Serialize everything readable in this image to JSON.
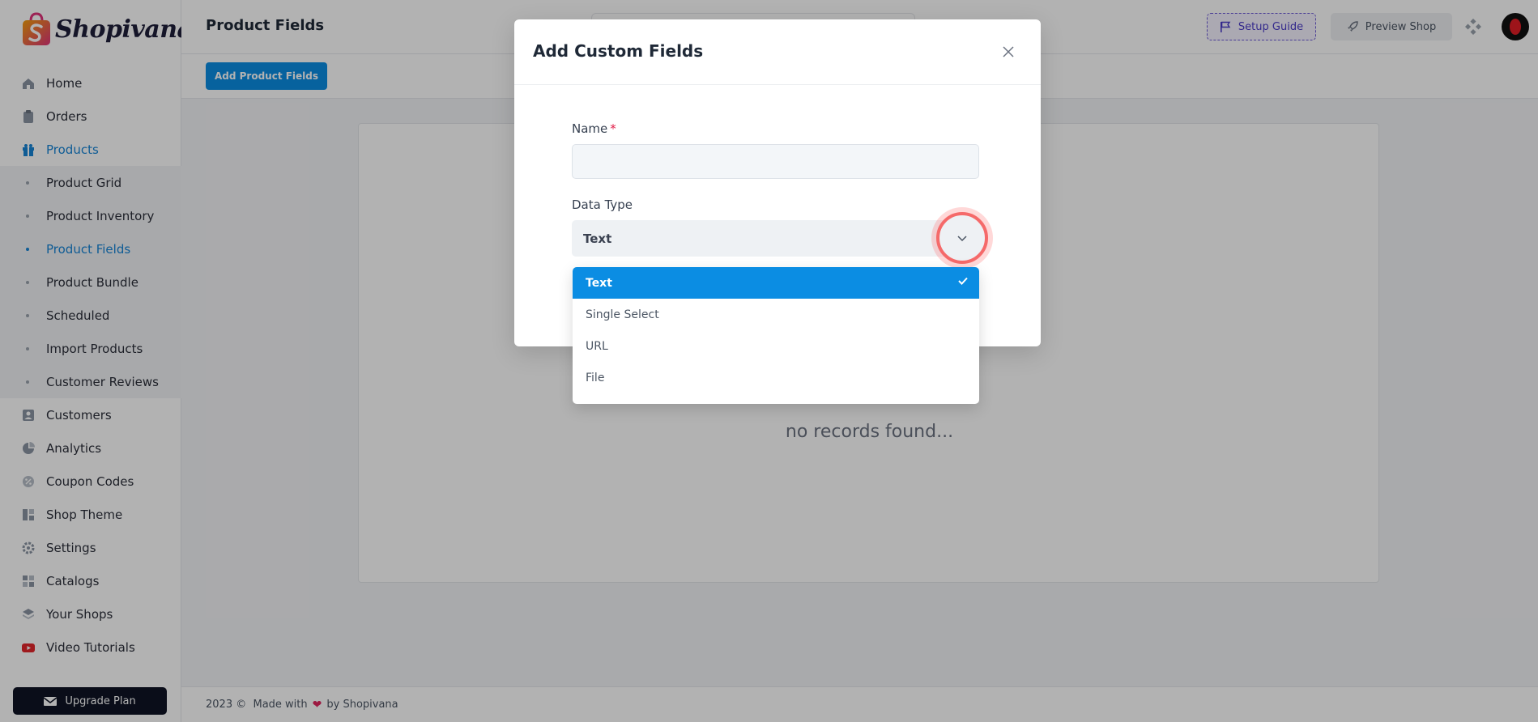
{
  "brand": {
    "name": "Shopivana",
    "colors": {
      "accent": "#0b8de3",
      "active_nav": "#1684d6",
      "logo_pink": "#e0337a",
      "logo_orange": "#f59e0b"
    }
  },
  "sidebar": {
    "items": [
      {
        "label": "Home",
        "icon": "home-icon"
      },
      {
        "label": "Orders",
        "icon": "clipboard-icon"
      },
      {
        "label": "Products",
        "icon": "gift-icon",
        "active": true
      }
    ],
    "sub_items": [
      {
        "label": "Product Grid"
      },
      {
        "label": "Product Inventory"
      },
      {
        "label": "Product Fields",
        "active": true
      },
      {
        "label": "Product Bundle"
      },
      {
        "label": "Scheduled"
      },
      {
        "label": "Import Products"
      },
      {
        "label": "Customer Reviews"
      }
    ],
    "bottom_items": [
      {
        "label": "Customers",
        "icon": "user-card-icon"
      },
      {
        "label": "Analytics",
        "icon": "pie-chart-icon"
      },
      {
        "label": "Coupon Codes",
        "icon": "coupon-icon"
      },
      {
        "label": "Shop Theme",
        "icon": "layout-icon"
      },
      {
        "label": "Settings",
        "icon": "gear-icon"
      },
      {
        "label": "Catalogs",
        "icon": "grid-icon"
      },
      {
        "label": "Your Shops",
        "icon": "layers-icon"
      },
      {
        "label": "Video Tutorials",
        "icon": "youtube-icon"
      }
    ],
    "upgrade_label": "Upgrade Plan"
  },
  "header": {
    "title": "Product Fields",
    "setup_guide_label": "Setup Guide",
    "preview_shop_label": "Preview Shop"
  },
  "toolbar": {
    "add_label": "Add Product Fields"
  },
  "main": {
    "empty_text": "no records found..."
  },
  "footer": {
    "year": "2023 ©",
    "made_with": "Made with",
    "by": "by Shopivana"
  },
  "modal": {
    "title": "Add Custom Fields",
    "name_label": "Name",
    "name_required": "*",
    "name_value": "",
    "data_type_label": "Data Type",
    "data_type_value": "Text",
    "options": [
      {
        "label": "Text",
        "selected": true
      },
      {
        "label": "Single Select"
      },
      {
        "label": "URL"
      },
      {
        "label": "File"
      }
    ]
  }
}
